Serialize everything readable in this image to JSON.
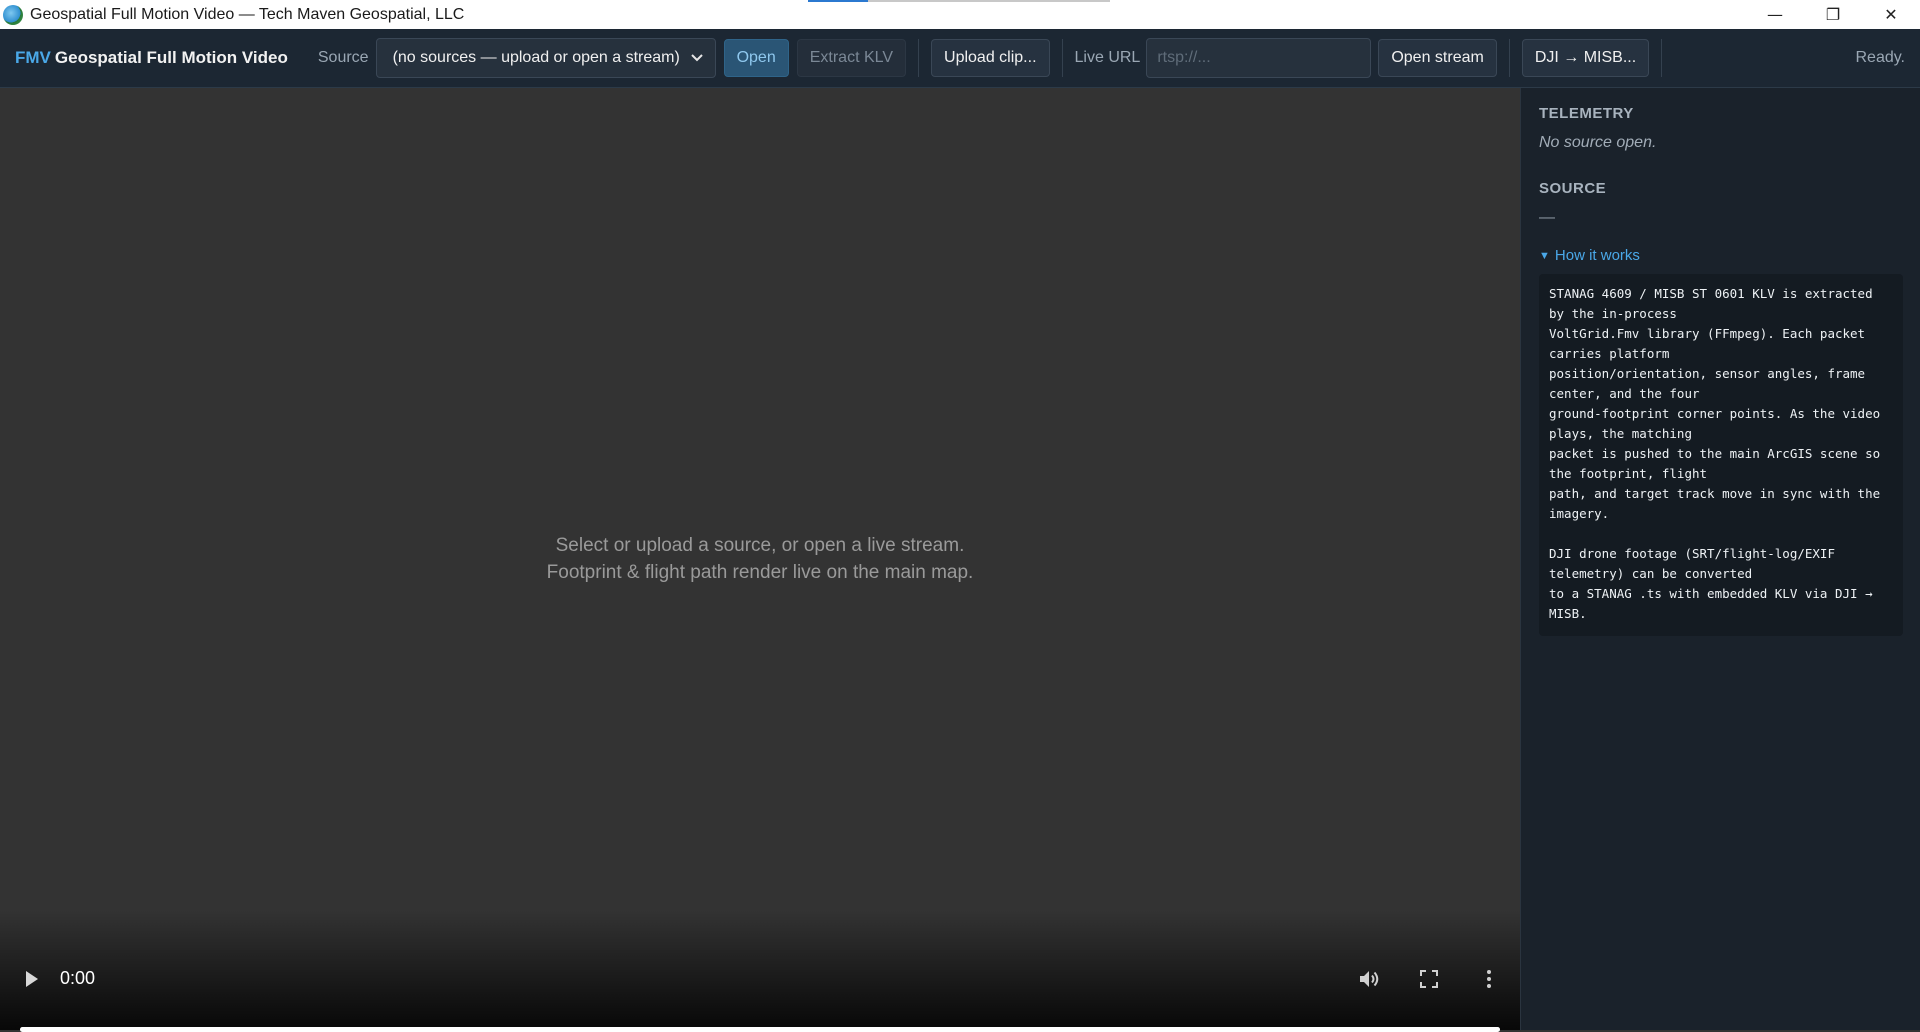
{
  "window": {
    "title": "Geospatial Full Motion Video — Tech Maven Geospatial, LLC",
    "minimize": "—",
    "restore": "❐",
    "close": "✕"
  },
  "toolbar": {
    "brand_code": "FMV",
    "brand_name": "Geospatial Full Motion Video",
    "source_label": "Source",
    "source_value": "(no sources — upload or open a stream)",
    "open_label": "Open",
    "extract_label": "Extract KLV",
    "upload_label": "Upload clip...",
    "live_url_label": "Live URL",
    "live_url_placeholder": "rtsp://...",
    "open_stream_label": "Open stream",
    "dji_label": "DJI → MISB...",
    "status": "Ready."
  },
  "video": {
    "placeholder_line1": "Select or upload a source, or open a live stream.",
    "placeholder_line2": "Footprint & flight path render live on the main map.",
    "time": "0:00",
    "progress": 1.0
  },
  "sidebar": {
    "telemetry_title": "TELEMETRY",
    "telemetry_value": "No source open.",
    "source_title": "SOURCE",
    "source_value": "—",
    "how_toggle": "How it works",
    "how_text": "STANAG 4609 / MISB ST 0601 KLV is extracted by the in-process\nVoltGrid.Fmv library (FFmpeg). Each packet carries platform\nposition/orientation, sensor angles, frame center, and the four\nground-footprint corner points. As the video plays, the matching\npacket is pushed to the main ArcGIS scene so the footprint, flight\npath, and target track move in sync with the imagery.\n\nDJI drone footage (SRT/flight-log/EXIF telemetry) can be converted\nto a STANAG .ts with embedded KLV via DJI → MISB."
  },
  "colors": {
    "accent": "#4aa8e8",
    "toolbar_bg": "#1c2733",
    "video_bg": "#333333",
    "panel_bg": "#1a222b"
  },
  "icons": [
    "app-globe-icon",
    "chevron-down-icon",
    "play-icon",
    "volume-icon",
    "fullscreen-icon",
    "more-vertical-icon",
    "disclosure-triangle-icon"
  ]
}
